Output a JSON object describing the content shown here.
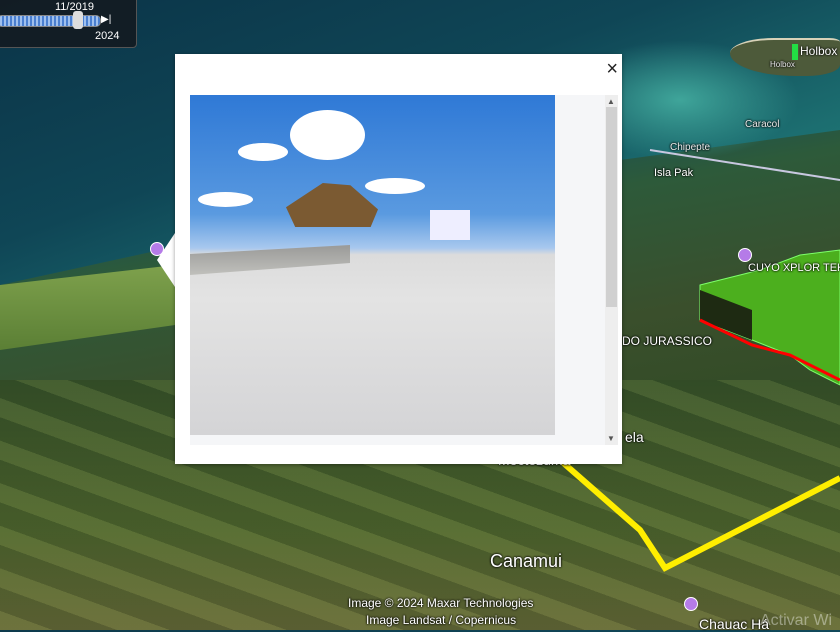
{
  "timeline": {
    "date": "11/2019",
    "end_year": "2024",
    "position": 0.78
  },
  "map_labels": {
    "holbox": "Holbox",
    "holbox_small": "Holbox",
    "caracol": "Caracol",
    "chipepte": "Chipepte",
    "isla_pak": "Isla Pak",
    "cuyo": "CUYO XPLOR TEKA",
    "jurassico": "DO JURASSICO",
    "ela": "ela",
    "moctezuma": "Moctezuma",
    "canamui": "Canamui",
    "chauac": "Chauac Há"
  },
  "credits": {
    "line1": "Image © 2024 Maxar Technologies",
    "line2": "Image Landsat / Copernicus"
  },
  "watermark": "Activar Wi",
  "popup": {
    "close": "×",
    "scroll_up": "▲",
    "scroll_down": "▼"
  }
}
